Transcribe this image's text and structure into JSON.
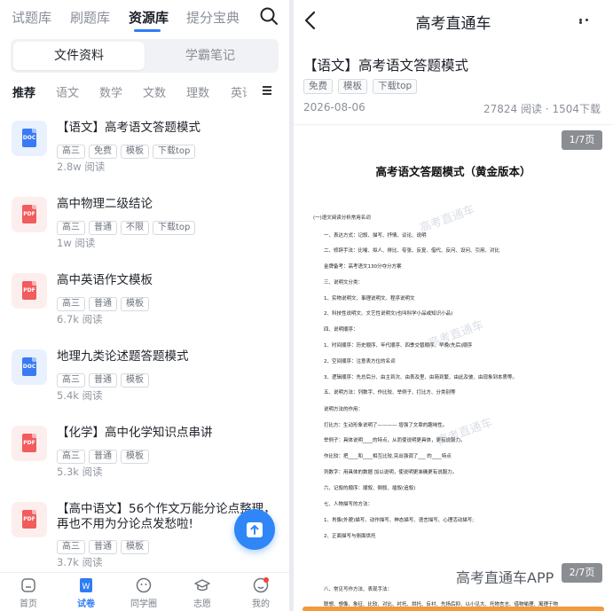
{
  "left": {
    "top_tabs": [
      {
        "label": "试题库",
        "active": false
      },
      {
        "label": "刷题库",
        "active": false
      },
      {
        "label": "资源库",
        "active": true
      },
      {
        "label": "提分宝典",
        "active": false
      }
    ],
    "segment": {
      "options": [
        "文件资料",
        "学霸笔记"
      ],
      "selected": 0
    },
    "subjects": [
      "推荐",
      "语文",
      "数学",
      "文数",
      "理数",
      "英语"
    ],
    "files": [
      {
        "type": "DOC",
        "title": "【语文】高考语文答题模式",
        "tags": [
          "高三",
          "免费",
          "模板",
          "下载top"
        ],
        "reads": "2.8w 阅读"
      },
      {
        "type": "PDF",
        "title": "高中物理二级结论",
        "tags": [
          "高三",
          "普通",
          "不限",
          "下载top"
        ],
        "reads": "1w 阅读"
      },
      {
        "type": "PDF",
        "title": "高中英语作文模板",
        "tags": [
          "高三",
          "普通",
          "模板"
        ],
        "reads": "6.7k 阅读"
      },
      {
        "type": "DOC",
        "title": "地理九类论述题答题模式",
        "tags": [
          "高三",
          "普通",
          "模板"
        ],
        "reads": "5.4k 阅读"
      },
      {
        "type": "PDF",
        "title": "【化学】高中化学知识点串讲",
        "tags": [
          "高三",
          "普通",
          "模板"
        ],
        "reads": "5.3k 阅读"
      },
      {
        "type": "PDF",
        "title": "【高中语文】56个作文万能分论点整理，再也不用为分论点发愁啦!",
        "tags": [
          "高三",
          "普通",
          "模板"
        ],
        "reads": "3.7k 阅读"
      }
    ],
    "bottom_nav": [
      {
        "label": "首页",
        "icon": "home-icon",
        "active": false
      },
      {
        "label": "试卷",
        "icon": "exam-icon",
        "active": true
      },
      {
        "label": "同学圈",
        "icon": "circle-icon",
        "active": false
      },
      {
        "label": "志愿",
        "icon": "graduation-icon",
        "active": false
      },
      {
        "label": "我的",
        "icon": "profile-icon",
        "active": false
      }
    ]
  },
  "right": {
    "header_title": "高考直通车",
    "doc_title": "【语文】高考语文答题模式",
    "tags": [
      "免费",
      "模板",
      "下载top"
    ],
    "date": "2026-08-06",
    "stats": "27824 阅读 · 1504下载",
    "page_indicator": "1/7页",
    "page_indicator_bottom": "2/7页",
    "sheet_title": "高考语文答题模式（黄金版本）",
    "sheet_lines": [
      "(一)语文阅读分析常用名词",
      "一、表达方式：记叙、描写、抒情、议论、说明",
      "二、修辞手法：比喻、拟人、排比、夸张、反复、借代、反问、设问、引用、对比",
      "金牌备考：高考语文130分夺分方案",
      "三、说明文分类：",
      "1、实物说明文、事理说明文、程序说明文",
      "2、科技性说明文、文艺性说明文(也叫科学小品或知识小品)",
      "四、说明顺序：",
      "1、时间顺序：历史顺序、年代顺序、四季交替顺序、早晚(先后)顺序",
      "2、空间顺序：注意表方位的名词",
      "3、逻辑顺序：先总后分、由主到次、由表及里、由简到繁、由此及彼、由现象到本质等。",
      "五、说明方法：列数字、作比较、举例子、打比方、分类别等",
      "说明方法的作用：",
      "打比方：生动形象说明了———— 增强了文章的趣味性。",
      "举例子：具体说明____的特点，从而使说明更具体，更有说服力。",
      "作比较：把____和____相互比较,突出强调了___ 的____特点",
      "列数字：用具体的数据 加以说明，使说明更准确更有说服力。",
      "六、记叙的顺序：顺叙、倒叙、插叙(追叙)",
      "七、人物描写的方法：",
      "1、肖像(外貌)描写、动作描写、神态描写、语言描写、心理活动描写;",
      "2、正面描写与侧面烘托",
      "八、常见写作方法、表现手法：",
      "联想、想像、象征、比较、对比、衬托、烘托、反衬、先扬后抑、以小见大、托物言志、借物喻理、寓理于物"
    ],
    "watermark": "高考直通车",
    "brand": "高考直通车APP",
    "colors": {
      "accent": "#2f7cf6",
      "pdf": "#f15c5c",
      "doc": "#3a7af3"
    }
  }
}
